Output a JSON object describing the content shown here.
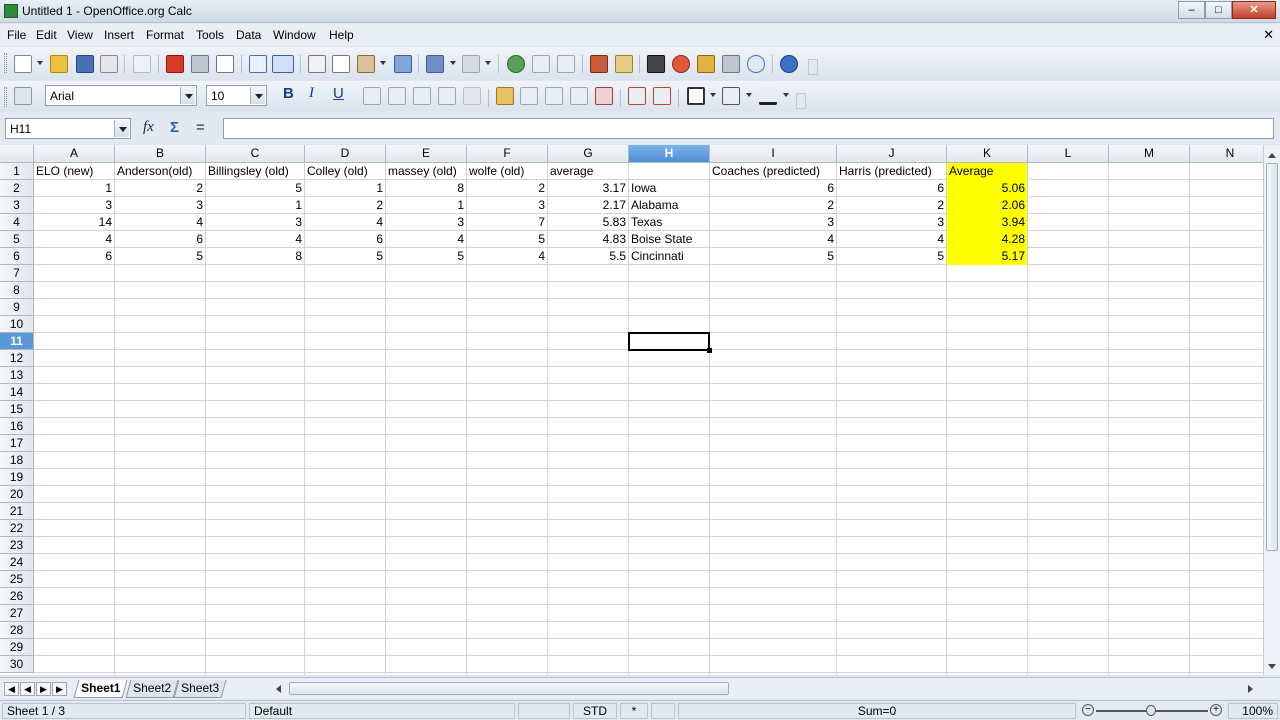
{
  "window": {
    "title": "Untitled 1 - OpenOffice.org Calc",
    "minimize": "–",
    "maximize": "□",
    "close": "✕"
  },
  "menu": [
    "File",
    "Edit",
    "View",
    "Insert",
    "Format",
    "Tools",
    "Data",
    "Window",
    "Help"
  ],
  "doc_close": "✕",
  "formatting": {
    "font_name": "Arial",
    "font_size": "10",
    "bold": "B",
    "italic": "I",
    "underline": "U"
  },
  "formula_bar": {
    "cell_ref": "H11",
    "formula": "",
    "function_wizard": "fx",
    "sum": "Σ",
    "function": "="
  },
  "sheet": {
    "columns": [
      "A",
      "B",
      "C",
      "D",
      "E",
      "F",
      "G",
      "H",
      "I",
      "J",
      "K",
      "L",
      "M",
      "N"
    ],
    "selected_column": "H",
    "selected_row": "11",
    "rows": [
      "1",
      "2",
      "3",
      "4",
      "5",
      "6",
      "7",
      "8",
      "9",
      "10",
      "11",
      "12",
      "13",
      "14",
      "15",
      "16",
      "17",
      "18",
      "19",
      "20",
      "21",
      "22",
      "23",
      "24",
      "25",
      "26",
      "27",
      "28",
      "29",
      "30"
    ],
    "header_row": [
      "ELO (new)",
      "Anderson(old)",
      "Billingsley (old)",
      "Colley (old)",
      "massey (old)",
      "wolfe (old)",
      "average",
      "",
      "Coaches (predicted)",
      "Harris (predicted)",
      "Average"
    ],
    "data_rows": [
      [
        "1",
        "2",
        "5",
        "1",
        "8",
        "2",
        "3.17",
        "Iowa",
        "6",
        "6",
        "5.06"
      ],
      [
        "3",
        "3",
        "1",
        "2",
        "1",
        "3",
        "2.17",
        "Alabama",
        "2",
        "2",
        "2.06"
      ],
      [
        "14",
        "4",
        "3",
        "4",
        "3",
        "7",
        "5.83",
        "Texas",
        "3",
        "3",
        "3.94"
      ],
      [
        "4",
        "6",
        "4",
        "6",
        "4",
        "5",
        "4.83",
        "Boise State",
        "4",
        "4",
        "4.28"
      ],
      [
        "6",
        "5",
        "8",
        "5",
        "5",
        "4",
        "5.5",
        "Cincinnati",
        "5",
        "5",
        "5.17"
      ]
    ],
    "highlight_color": "#ffff00"
  },
  "sheet_tabs": [
    "Sheet1",
    "Sheet2",
    "Sheet3"
  ],
  "active_sheet": "Sheet1",
  "status": {
    "sheet": "Sheet 1 / 3",
    "style": "Default",
    "mode": "STD",
    "modified": "*",
    "sum": "Sum=0",
    "zoom": "100%"
  },
  "icons": {
    "new": "new-document-icon",
    "open": "open-folder-icon",
    "save": "save-icon",
    "email": "email-icon",
    "edit_file": "edit-file-icon",
    "pdf": "export-pdf-icon",
    "print": "print-icon",
    "preview": "page-preview-icon",
    "spell": "spellcheck-icon",
    "autospell": "autospellcheck-icon",
    "cut": "cut-icon",
    "copy": "copy-icon",
    "paste": "paste-icon",
    "clone": "clone-formatting-icon",
    "undo": "undo-icon",
    "redo": "redo-icon",
    "hyperlink": "hyperlink-icon",
    "sort_asc": "sort-ascending-icon",
    "sort_desc": "sort-descending-icon",
    "chart": "chart-icon",
    "draw": "show-draw-functions-icon",
    "find": "find-replace-icon",
    "navigator": "navigator-icon",
    "gallery": "gallery-icon",
    "datasources": "data-sources-icon",
    "zoom": "zoom-icon",
    "help": "help-icon"
  }
}
